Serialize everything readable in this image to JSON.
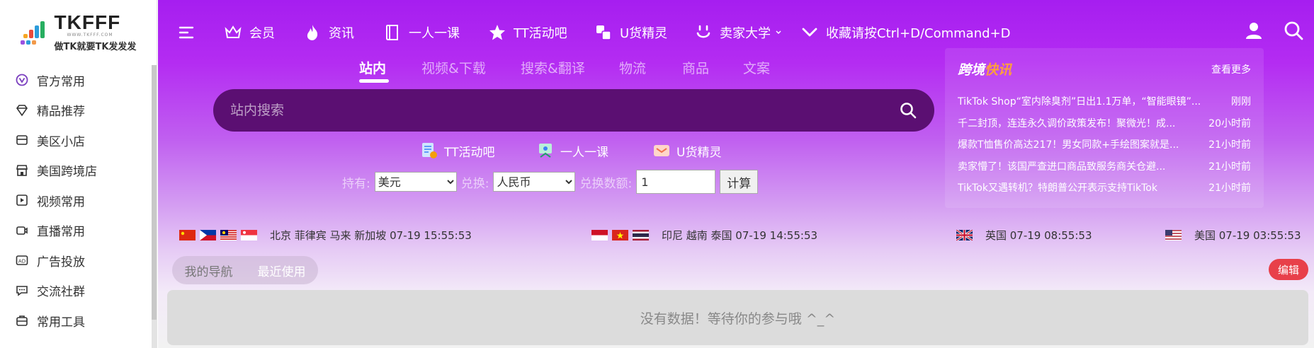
{
  "brand": {
    "name": "TKFFF",
    "url": "WWW.TKFFF.COM",
    "slogan": "做TK就要TK发发发"
  },
  "sidebar": {
    "items": [
      {
        "label": "官方常用",
        "icon": "official-icon"
      },
      {
        "label": "精品推荐",
        "icon": "diamond-icon"
      },
      {
        "label": "美区小店",
        "icon": "store-icon"
      },
      {
        "label": "美国跨境店",
        "icon": "shop-icon"
      },
      {
        "label": "视频常用",
        "icon": "video-icon"
      },
      {
        "label": "直播常用",
        "icon": "live-icon"
      },
      {
        "label": "广告投放",
        "icon": "ad-icon"
      },
      {
        "label": "交流社群",
        "icon": "chat-icon"
      },
      {
        "label": "常用工具",
        "icon": "toolbox-icon"
      }
    ]
  },
  "topnav": {
    "items": [
      {
        "label": "会员",
        "icon": "crown-icon"
      },
      {
        "label": "资讯",
        "icon": "flame-icon"
      },
      {
        "label": "一人一课",
        "icon": "book-icon"
      },
      {
        "label": "TT活动吧",
        "icon": "star-icon"
      },
      {
        "label": "U货精灵",
        "icon": "boxes-icon"
      },
      {
        "label": "卖家大学",
        "icon": "smile-icon"
      },
      {
        "label": "收藏请按Ctrl+D/Command+D",
        "icon": "check-icon"
      }
    ]
  },
  "search": {
    "tabs": [
      "站内",
      "视频&下载",
      "搜索&翻译",
      "物流",
      "商品",
      "文案"
    ],
    "placeholder": "站内搜索"
  },
  "quicklinks": [
    "TT活动吧",
    "一人一课",
    "U货精灵"
  ],
  "converter": {
    "hold_label": "持有:",
    "hold_value": "美元",
    "exchange_label": "兑换:",
    "exchange_value": "人民币",
    "amount_label": "兑换数额:",
    "amount_value": "1",
    "calc_label": "计算"
  },
  "news": {
    "title_a": "跨境",
    "title_b": "快讯",
    "more": "查看更多",
    "items": [
      {
        "text": "TikTok Shop“室内除臭剂”日出1.1万单，“智能眼镜”...",
        "time": "刚刚"
      },
      {
        "text": "千二封顶，连连永久调价政策发布！聚微光！成...",
        "time": "20小时前"
      },
      {
        "text": "爆款T恤售价高达217！男女同款+手绘图案就是...",
        "time": "21小时前"
      },
      {
        "text": "卖家懵了！该国严查进口商品致服务商关仓避...",
        "time": "21小时前"
      },
      {
        "text": "TikTok又遇转机？特朗普公开表示支持TikTok",
        "time": "21小时前"
      }
    ]
  },
  "clocks": [
    {
      "label": "北京 菲律宾 马来 新加坡 07-19 15:55:53"
    },
    {
      "label": "印尼 越南 泰国 07-19 14:55:53"
    },
    {
      "label": "英国 07-19 08:55:53"
    },
    {
      "label": "美国 07-19 03:55:53"
    }
  ],
  "navtabs": {
    "mine": "我的导航",
    "recent": "最近使用",
    "edit": "编辑"
  },
  "empty_text": "没有数据！等待你的参与哦 ^_^",
  "colors": {
    "accent": "#a61ef0",
    "search_bg": "#5b0f72",
    "edit": "#e8404a",
    "news_highlight": "#ff9f3a"
  }
}
